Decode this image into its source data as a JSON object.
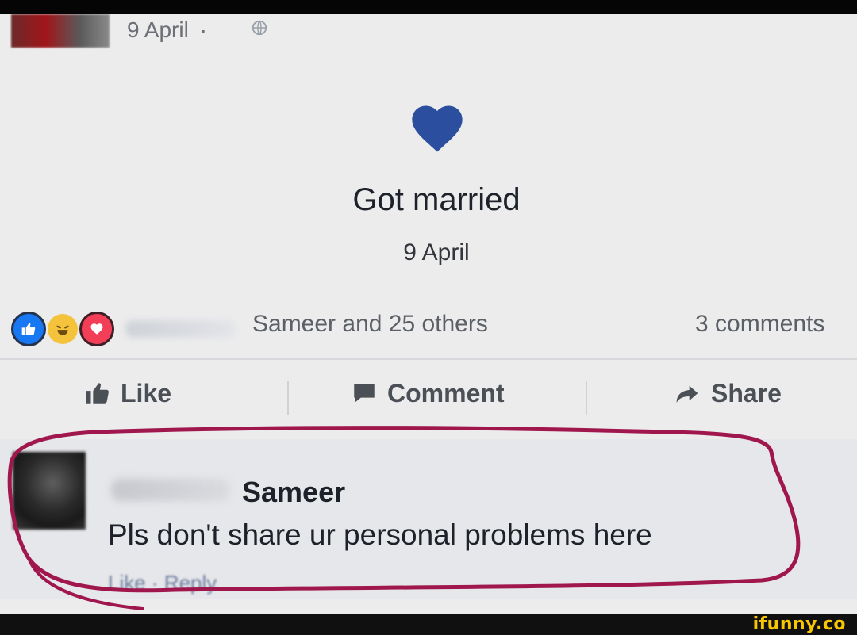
{
  "post": {
    "date": "9 April",
    "date_separator": "·",
    "globe_icon": "globe-icon"
  },
  "life_event": {
    "icon": "heart-icon",
    "icon_color": "#2b4f9e",
    "title": "Got married",
    "date": "9 April"
  },
  "reactions": {
    "icons": [
      "like-icon",
      "haha-icon",
      "love-icon"
    ],
    "summary": "Sameer and 25 others",
    "comments_count": "3 comments"
  },
  "actions": {
    "like": "Like",
    "comment": "Comment",
    "share": "Share"
  },
  "comment": {
    "author": "Sameer",
    "text": "Pls don't share ur personal problems here",
    "like_link": "Like",
    "separator": " · ",
    "reply_link": "Reply"
  },
  "annotation": {
    "stroke_color": "#a0174e"
  },
  "footer": {
    "brand": "ifunny.co",
    "brand_color": "#f7c600"
  }
}
